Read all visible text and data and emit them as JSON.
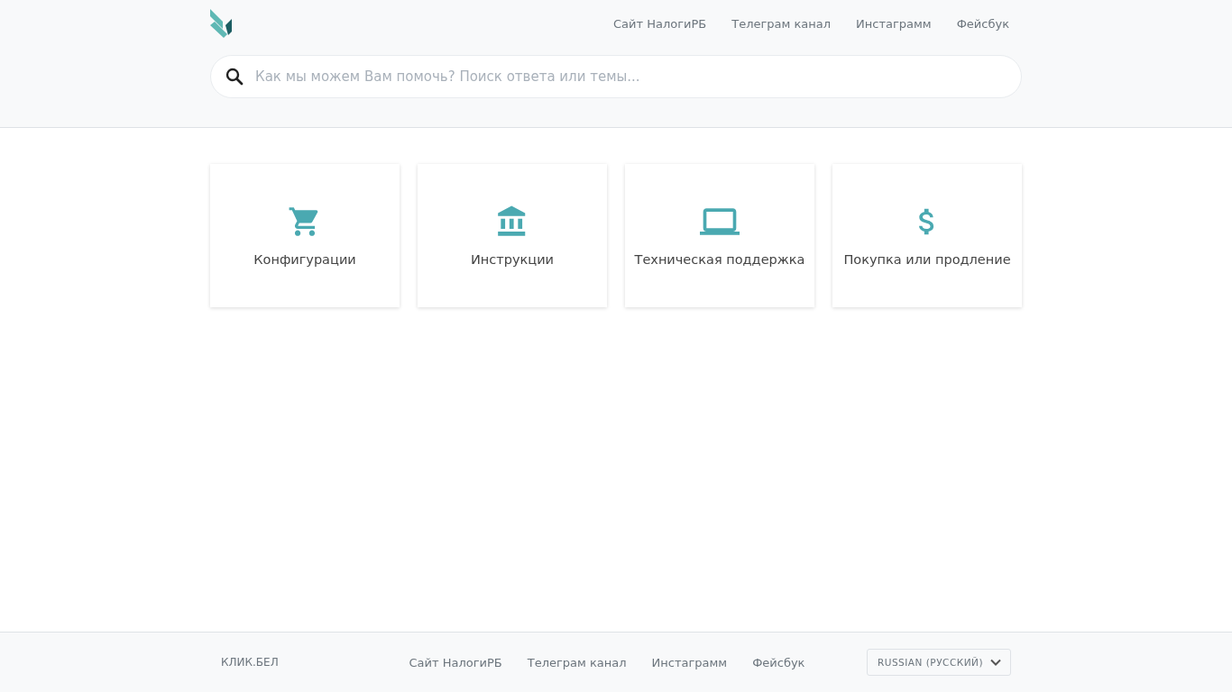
{
  "header": {
    "nav": [
      "Сайт НалогиРБ",
      "Телеграм канал",
      "Инстаграмм",
      "Фейсбук"
    ],
    "search": {
      "placeholder": "Как мы можем Вам помочь? Поиск ответа или темы..."
    }
  },
  "categories": [
    {
      "kind": "cart",
      "label": "Конфигурации"
    },
    {
      "kind": "bank",
      "label": "Инструкции"
    },
    {
      "kind": "laptop",
      "label": "Техническая поддержка"
    },
    {
      "kind": "dollar",
      "label": "Покупка или продление"
    }
  ],
  "footer": {
    "brand": "КЛИК.БЕЛ",
    "nav": [
      "Сайт НалогиРБ",
      "Телеграм канал",
      "Инстаграмм",
      "Фейсбук"
    ],
    "language": "RUSSIAN (РУССКИЙ)"
  }
}
